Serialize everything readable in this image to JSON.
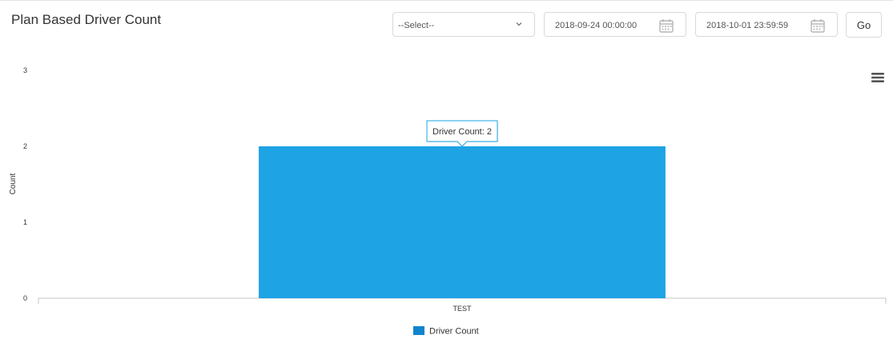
{
  "page": {
    "title": "Plan Based Driver Count"
  },
  "filters": {
    "select_value": "--Select--",
    "start_date": "2018-09-24 00:00:00",
    "end_date": "2018-10-01 23:59:59",
    "go_label": "Go"
  },
  "colors": {
    "bar": "#1ea3e5",
    "legend": "#1184cc",
    "tooltip_border": "#1ea3e5"
  },
  "icons": {
    "select": "chevron-down-icon",
    "date": "calendar-icon",
    "menu": "hamburger-icon"
  },
  "chart_data": {
    "type": "bar",
    "title": "",
    "xlabel": "",
    "ylabel": "Count",
    "categories": [
      "TEST"
    ],
    "series": [
      {
        "name": "Driver Count",
        "values": [
          2
        ]
      }
    ],
    "ylim": [
      0,
      3
    ],
    "yticks": [
      "0",
      "1",
      "2",
      "3"
    ],
    "grid": false,
    "legend": "bottom-center",
    "tooltip": "Driver Count: 2"
  }
}
